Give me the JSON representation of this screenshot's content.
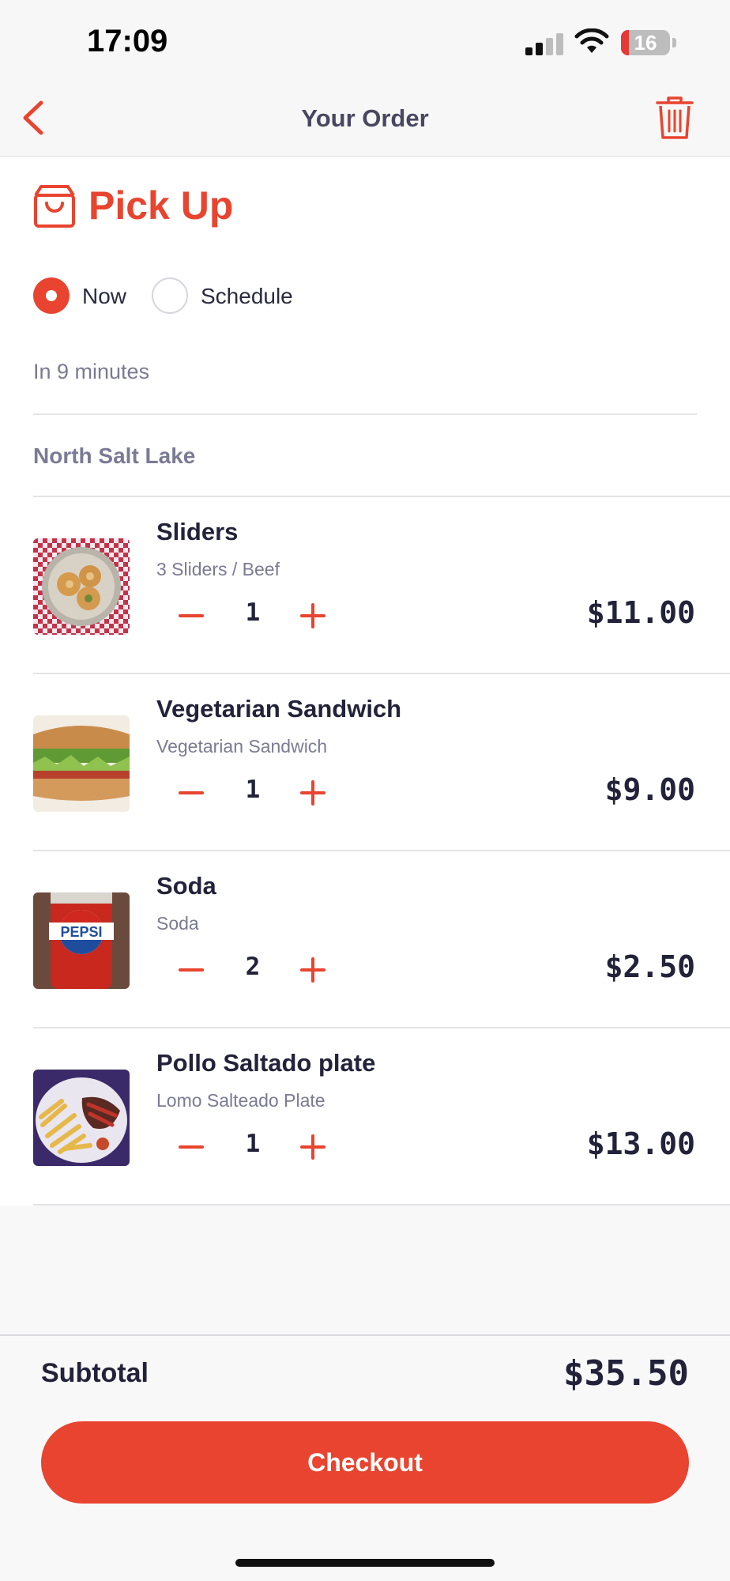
{
  "status_bar": {
    "time": "17:09",
    "battery_level": "16",
    "battery_fraction": 0.16
  },
  "nav": {
    "title": "Your Order",
    "back_icon": "chevron-left-icon",
    "trash_icon": "trash-icon"
  },
  "fulfillment": {
    "mode": "Pick Up",
    "icon": "shopping-bag-icon",
    "options": [
      {
        "label": "Now",
        "selected": true
      },
      {
        "label": "Schedule",
        "selected": false
      }
    ],
    "eta": "In 9 minutes"
  },
  "location": "North Salt Lake",
  "items": [
    {
      "name": "Sliders",
      "description": "3 Sliders / Beef",
      "quantity": "1",
      "price": "$11.00",
      "image": "sliders-photo"
    },
    {
      "name": "Vegetarian Sandwich",
      "description": "Vegetarian Sandwich",
      "quantity": "1",
      "price": "$9.00",
      "image": "sandwich-photo"
    },
    {
      "name": "Soda",
      "description": "Soda",
      "quantity": "2",
      "price": "$2.50",
      "image": "soda-can-photo"
    },
    {
      "name": "Pollo Saltado plate",
      "description": "Lomo Salteado Plate",
      "quantity": "1",
      "price": "$13.00",
      "image": "saltado-plate-photo"
    }
  ],
  "footer": {
    "subtotal_label": "Subtotal",
    "subtotal_value": "$35.50",
    "checkout_label": "Checkout"
  },
  "colors": {
    "accent": "#e8442f",
    "text_dark": "#22223a",
    "text_muted": "#7a7a93"
  },
  "soda_logo_text": "PEPSI"
}
